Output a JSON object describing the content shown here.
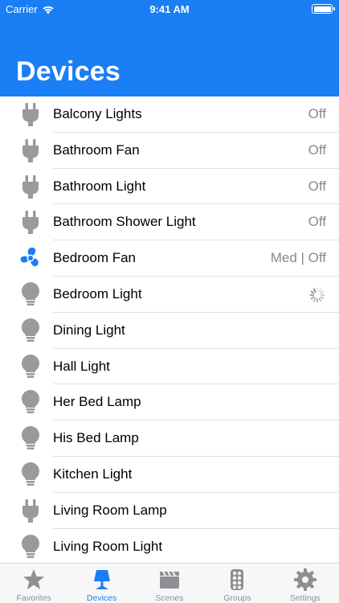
{
  "status_bar": {
    "carrier": "Carrier",
    "time": "9:41 AM"
  },
  "header": {
    "title": "Devices"
  },
  "devices": [
    {
      "name": "Balcony Lights",
      "state": "Off",
      "icon": "plug-icon"
    },
    {
      "name": "Bathroom Fan",
      "state": "Off",
      "icon": "plug-icon"
    },
    {
      "name": "Bathroom Light",
      "state": "Off",
      "icon": "plug-icon"
    },
    {
      "name": "Bathroom Shower Light",
      "state": "Off",
      "icon": "plug-icon"
    },
    {
      "name": "Bedroom Fan",
      "state": "Med | Off",
      "icon": "fan-icon"
    },
    {
      "name": "Bedroom Light",
      "state": "",
      "icon": "bulb-icon",
      "loading": true
    },
    {
      "name": "Dining Light",
      "state": "",
      "icon": "bulb-icon"
    },
    {
      "name": "Hall Light",
      "state": "",
      "icon": "bulb-icon"
    },
    {
      "name": "Her Bed Lamp",
      "state": "",
      "icon": "bulb-icon"
    },
    {
      "name": "His Bed Lamp",
      "state": "",
      "icon": "bulb-icon"
    },
    {
      "name": "Kitchen Light",
      "state": "",
      "icon": "bulb-icon"
    },
    {
      "name": "Living Room Lamp",
      "state": "",
      "icon": "plug-icon"
    },
    {
      "name": "Living Room Light",
      "state": "",
      "icon": "bulb-icon"
    }
  ],
  "tabs": [
    {
      "label": "Favorites",
      "icon": "star-icon",
      "active": false
    },
    {
      "label": "Devices",
      "icon": "lamp-icon",
      "active": true
    },
    {
      "label": "Scenes",
      "icon": "clapperboard-icon",
      "active": false
    },
    {
      "label": "Groups",
      "icon": "groups-icon",
      "active": false
    },
    {
      "label": "Settings",
      "icon": "gear-icon",
      "active": false
    }
  ],
  "colors": {
    "accent": "#1a7ef5",
    "icon_gray": "#9a9a9a",
    "tab_gray": "#8e8e93"
  }
}
